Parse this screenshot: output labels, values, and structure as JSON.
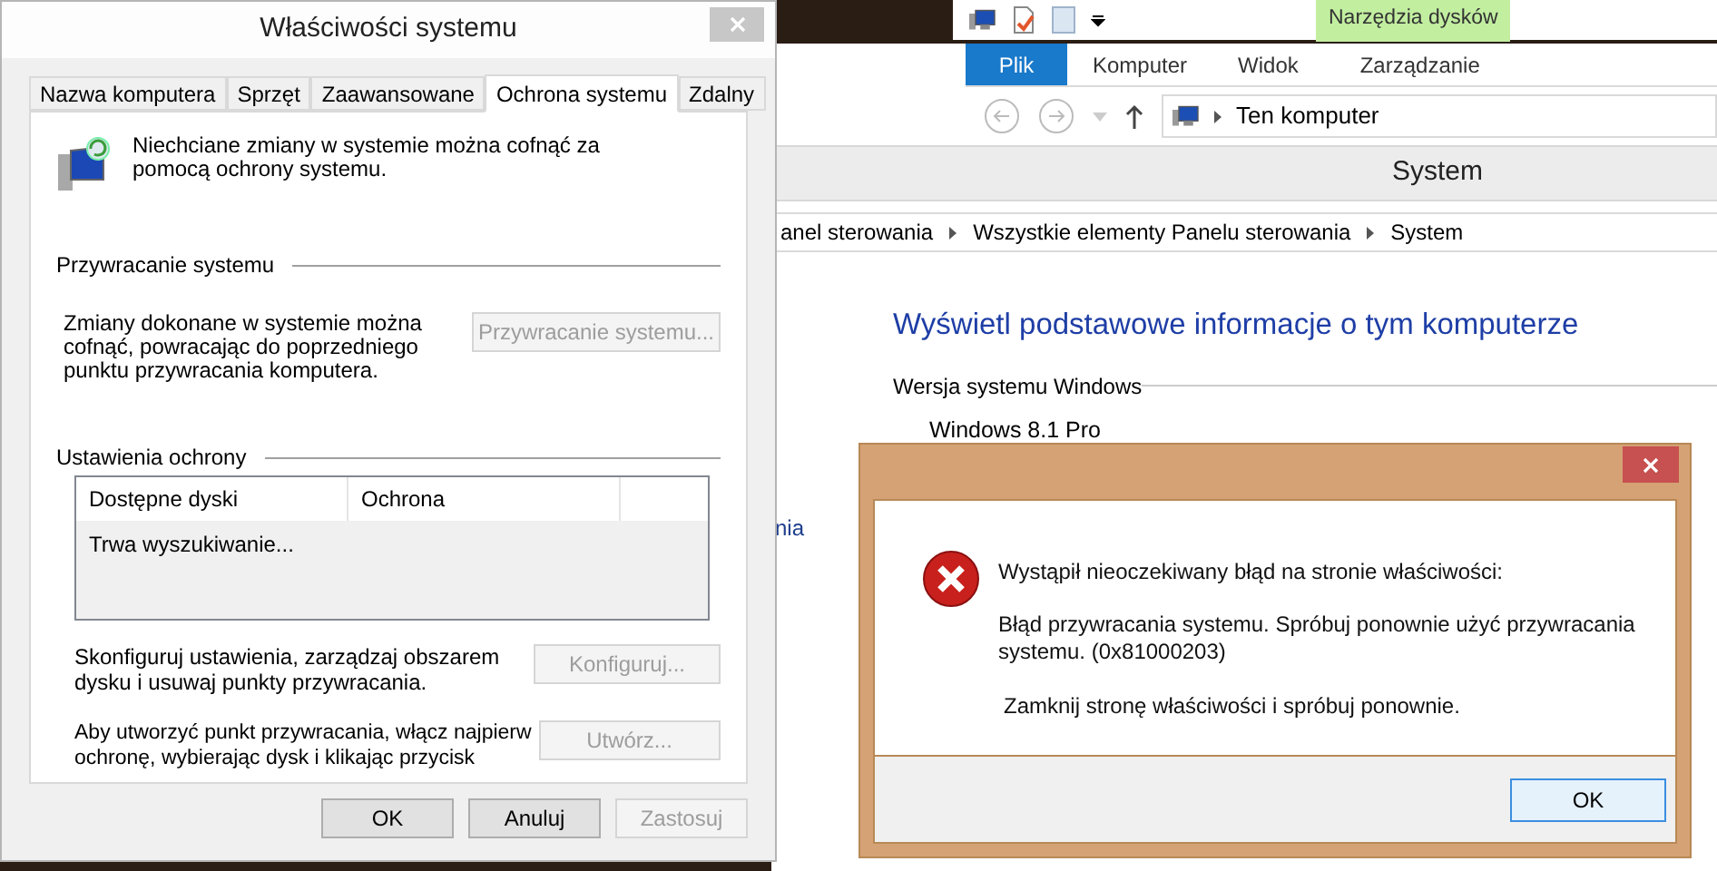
{
  "explorer": {
    "ribbon_context_tab": "Narzędzia dysków",
    "ribbon_tabs": [
      {
        "label": "Plik",
        "selected": true
      },
      {
        "label": "Komputer",
        "selected": false
      },
      {
        "label": "Widok",
        "selected": false
      },
      {
        "label": "Zarządzanie",
        "selected": false
      }
    ],
    "address": "Ten komputer"
  },
  "control_panel": {
    "title": "System",
    "breadcrumb": [
      "anel sterowania",
      "Wszystkie elementy Panelu sterowania",
      "System"
    ],
    "heading": "Wyświetl podstawowe informacje o tym komputerze",
    "section": "Wersja systemu Windows",
    "edition": "Windows 8.1 Pro",
    "side_fragment": "nia"
  },
  "properties": {
    "title": "Właściwości systemu",
    "tabs": [
      {
        "label": "Nazwa komputera",
        "selected": false
      },
      {
        "label": "Sprzęt",
        "selected": false
      },
      {
        "label": "Zaawansowane",
        "selected": false
      },
      {
        "label": "Ochrona systemu",
        "selected": true
      },
      {
        "label": "Zdalny",
        "selected": false
      }
    ],
    "intro": "Niechciane zmiany w systemie można cofnąć za pomocą ochrony systemu.",
    "restore_group": "Przywracanie systemu",
    "restore_text": "Zmiany dokonane w systemie można cofnąć, powracając do poprzedniego punktu przywracania komputera.",
    "restore_button": {
      "label": "Przywracanie systemu...",
      "disabled": true
    },
    "settings_group": "Ustawienia ochrony",
    "columns": [
      "Dostępne dyski",
      "Ochrona"
    ],
    "list_status": "Trwa wyszukiwanie...",
    "configure_text": "Skonfiguruj ustawienia, zarządzaj obszarem dysku i usuwaj punkty przywracania.",
    "configure_button": {
      "label": "Konfiguruj...",
      "disabled": true
    },
    "create_text": "Aby utworzyć punkt przywracania, włącz najpierw ochronę, wybierając dysk i klikając przycisk",
    "create_button": {
      "label": "Utwórz...",
      "disabled": true
    },
    "buttons": [
      {
        "label": "OK",
        "disabled": false
      },
      {
        "label": "Anuluj",
        "disabled": false
      },
      {
        "label": "Zastosuj",
        "disabled": true
      }
    ]
  },
  "error_dialog": {
    "message": "Wystąpił nieoczekiwany błąd na stronie właściwości:",
    "detail": "Błąd przywracania systemu. Spróbuj ponownie użyć przywracania systemu. (0x81000203)",
    "hint": "Zamknij stronę właściwości i spróbuj ponownie.",
    "button": "OK"
  }
}
